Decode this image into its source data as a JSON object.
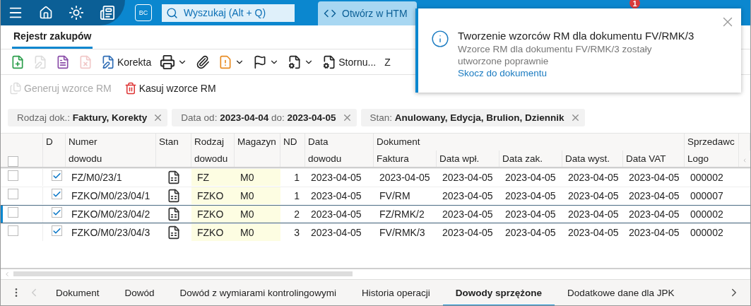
{
  "top_bar": {
    "search": {
      "placeholder": "Wyszukaj (Alt + Q)"
    },
    "open_button": "Otwórz w HTM",
    "notification_count": "1",
    "app_badge": "BC"
  },
  "tabs": [
    {
      "label": "Rejestr zakupów",
      "selected": true
    }
  ],
  "toolbar": [
    {
      "disabled": false
    },
    {
      "disabled": true
    },
    {
      "disabled": false
    },
    {
      "disabled": true
    },
    {
      "label": "Korekta",
      "disabled": false
    },
    {
      "disabled": false,
      "dropdown": true
    },
    {
      "disabled": false
    },
    {
      "disabled": false,
      "dropdown": true
    },
    {
      "disabled": false,
      "dropdown": true
    },
    {
      "disabled": false,
      "dropdown": true
    },
    {
      "label": "Stornu...",
      "disabled": false
    },
    {
      "label": "Z",
      "disabled": false
    }
  ],
  "actions": [
    {
      "label": "Generuj wzorce RM",
      "disabled": true
    },
    {
      "label": "Kasuj wzorce RM",
      "disabled": false
    }
  ],
  "filters": [
    "Rodzaj dok.: **Faktury, Korekty**",
    "Data  od: **2023-04-04**  do: **2023-04-05**",
    "Stan: **Anulowany, Edycja, Brulion, Dziennik**"
  ],
  "table": {
    "group_header": "Dokument",
    "check_column": "D",
    "status_column": "Stan",
    "columns": [
      {
        "top": "Numer",
        "bottom": "dowodu"
      },
      {
        "top": "Rodzaj",
        "bottom": "dowodu"
      },
      {
        "top": "Magazyn"
      },
      {
        "top": "ND"
      },
      {
        "top": "Data",
        "bottom": "dowodu"
      },
      {
        "bottom": "Faktura"
      },
      {
        "bottom": "Data wpł."
      },
      {
        "bottom": "Data zak."
      },
      {
        "bottom": "Data wyst."
      },
      {
        "bottom": "Data VAT"
      },
      {
        "top": "Sprzedawc",
        "bottom": "Logo"
      }
    ],
    "all_marked": false,
    "rows": [
      {
        "marked": false,
        "d": true,
        "selected": false,
        "cells": [
          "FZ/M0/23/1",
          "FZ",
          "M0",
          "1",
          "2023-04-05",
          "2023-04-05",
          "2023-04-05",
          "2023-04-05",
          "2023-04-05",
          "2023-04-05",
          "000002"
        ]
      },
      {
        "marked": false,
        "d": true,
        "selected": false,
        "cells": [
          "FZKO/M0/23/04/1",
          "FZKO",
          "M0",
          "1",
          "2023-04-05",
          "FV/RM",
          "2023-04-05",
          "2023-04-05",
          "2023-04-05",
          "2023-04-05",
          "000007"
        ]
      },
      {
        "marked": false,
        "d": true,
        "selected": true,
        "cells": [
          "FZKO/M0/23/04/2",
          "FZKO",
          "M0",
          "2",
          "2023-04-05",
          "FZ/RMK/2",
          "2023-04-05",
          "2023-04-05",
          "2023-04-05",
          "2023-04-05",
          "000002"
        ]
      },
      {
        "marked": false,
        "d": true,
        "selected": false,
        "cells": [
          "FZKO/M0/23/04/3",
          "FZKO",
          "M0",
          "3",
          "2023-04-05",
          "FV/RMK/3",
          "2023-04-05",
          "2023-04-05",
          "2023-04-05",
          "2023-04-05",
          "000002"
        ]
      }
    ]
  },
  "bottom_tabs": [
    {
      "label": "Dokument",
      "selected": false
    },
    {
      "label": "Dowód",
      "selected": false
    },
    {
      "label": "Dowód z wymiarami kontrolingowymi",
      "selected": false
    },
    {
      "label": "Historia operacji",
      "selected": false
    },
    {
      "label": "Dowody sprzężone",
      "selected": true
    },
    {
      "label": "Dodatkowe dane dla JPK",
      "selected": false
    }
  ],
  "toast": {
    "title": "Tworzenie wzorców RM dla dokumentu FV/RMK/3",
    "message": "Wzorce RM dla dokumentu FV/RMK/3 zostały utworzone poprawnie",
    "link": "Skocz do dokumentu"
  }
}
